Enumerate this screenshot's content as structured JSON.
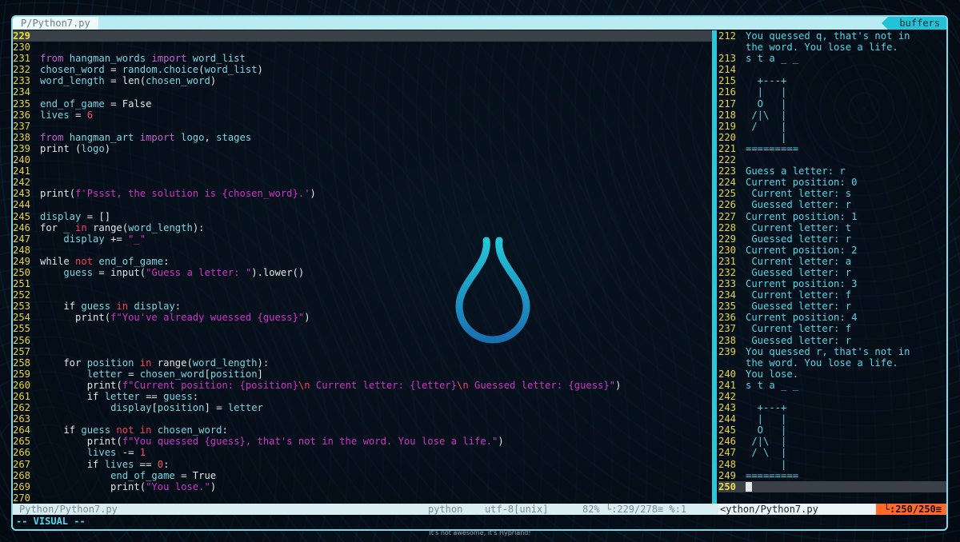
{
  "tabline": {
    "active_tab": "P/Python7.py",
    "buffers_label": "buffers"
  },
  "left_pane": {
    "lines": [
      {
        "n": "229",
        "current": true,
        "tokens": []
      },
      {
        "n": "230",
        "tokens": []
      },
      {
        "n": "231",
        "tokens": [
          [
            "kw",
            "from "
          ],
          [
            "id",
            "hangman_words "
          ],
          [
            "kw",
            "import "
          ],
          [
            "id",
            "word_list"
          ]
        ]
      },
      {
        "n": "232",
        "tokens": [
          [
            "id",
            "chosen_word "
          ],
          [
            "plain",
            "= "
          ],
          [
            "id",
            "random.choice"
          ],
          [
            "plain",
            "("
          ],
          [
            "id",
            "word_list"
          ],
          [
            "plain",
            ")"
          ]
        ]
      },
      {
        "n": "233",
        "tokens": [
          [
            "id",
            "word_length "
          ],
          [
            "plain",
            "= "
          ],
          [
            "plain",
            "len"
          ],
          [
            "plain",
            "("
          ],
          [
            "id",
            "chosen_word"
          ],
          [
            "plain",
            ")"
          ]
        ]
      },
      {
        "n": "234",
        "tokens": []
      },
      {
        "n": "235",
        "tokens": [
          [
            "id",
            "end_of_game "
          ],
          [
            "plain",
            "= False"
          ]
        ]
      },
      {
        "n": "236",
        "tokens": [
          [
            "id",
            "lives "
          ],
          [
            "plain",
            "= "
          ],
          [
            "num",
            "6"
          ]
        ]
      },
      {
        "n": "237",
        "tokens": []
      },
      {
        "n": "238",
        "tokens": [
          [
            "kw",
            "from "
          ],
          [
            "id",
            "hangman_art "
          ],
          [
            "kw",
            "import "
          ],
          [
            "id",
            "logo"
          ],
          [
            "plain",
            ", "
          ],
          [
            "id",
            "stages"
          ]
        ]
      },
      {
        "n": "239",
        "tokens": [
          [
            "plain",
            "print "
          ],
          [
            "plain",
            "("
          ],
          [
            "id",
            "logo"
          ],
          [
            "plain",
            ")"
          ]
        ]
      },
      {
        "n": "240",
        "tokens": []
      },
      {
        "n": "241",
        "tokens": []
      },
      {
        "n": "242",
        "tokens": []
      },
      {
        "n": "243",
        "tokens": [
          [
            "plain",
            "print"
          ],
          [
            "plain",
            "("
          ],
          [
            "str",
            "f'Pssst, the solution is {chosen_word}.'"
          ],
          [
            "plain",
            ")"
          ]
        ]
      },
      {
        "n": "244",
        "tokens": []
      },
      {
        "n": "245",
        "tokens": [
          [
            "id",
            "display "
          ],
          [
            "plain",
            "= []"
          ]
        ]
      },
      {
        "n": "246",
        "tokens": [
          [
            "plain",
            "for "
          ],
          [
            "id",
            "_ "
          ],
          [
            "op",
            "in "
          ],
          [
            "plain",
            "range"
          ],
          [
            "plain",
            "("
          ],
          [
            "id",
            "word_length"
          ],
          [
            "plain",
            "):"
          ]
        ]
      },
      {
        "n": "247",
        "tokens": [
          [
            "plain",
            "    "
          ],
          [
            "id",
            "display "
          ],
          [
            "plain",
            "+= "
          ],
          [
            "str",
            "\"_\""
          ]
        ]
      },
      {
        "n": "248",
        "tokens": []
      },
      {
        "n": "249",
        "tokens": [
          [
            "plain",
            "while "
          ],
          [
            "op",
            "not "
          ],
          [
            "id",
            "end_of_game"
          ],
          [
            "plain",
            ":"
          ]
        ]
      },
      {
        "n": "250",
        "tokens": [
          [
            "plain",
            "    "
          ],
          [
            "id",
            "guess "
          ],
          [
            "plain",
            "= input"
          ],
          [
            "plain",
            "("
          ],
          [
            "str",
            "\"Guess a letter: \""
          ],
          [
            "plain",
            ").lower()"
          ]
        ]
      },
      {
        "n": "251",
        "tokens": []
      },
      {
        "n": "252",
        "tokens": []
      },
      {
        "n": "253",
        "tokens": [
          [
            "plain",
            "    if "
          ],
          [
            "id",
            "guess "
          ],
          [
            "op",
            "in "
          ],
          [
            "id",
            "display"
          ],
          [
            "plain",
            ":"
          ]
        ]
      },
      {
        "n": "254",
        "tokens": [
          [
            "plain",
            "      print"
          ],
          [
            "plain",
            "("
          ],
          [
            "str",
            "f\"You've already wuessed {guess}\""
          ],
          [
            "plain",
            ")"
          ]
        ]
      },
      {
        "n": "255",
        "tokens": []
      },
      {
        "n": "256",
        "tokens": []
      },
      {
        "n": "257",
        "tokens": []
      },
      {
        "n": "258",
        "tokens": [
          [
            "plain",
            "    for "
          ],
          [
            "id",
            "position "
          ],
          [
            "op",
            "in "
          ],
          [
            "plain",
            "range"
          ],
          [
            "plain",
            "("
          ],
          [
            "id",
            "word_length"
          ],
          [
            "plain",
            "):"
          ]
        ]
      },
      {
        "n": "259",
        "tokens": [
          [
            "plain",
            "        "
          ],
          [
            "id",
            "letter "
          ],
          [
            "plain",
            "= "
          ],
          [
            "id",
            "chosen_word"
          ],
          [
            "plain",
            "["
          ],
          [
            "id",
            "position"
          ],
          [
            "plain",
            "]"
          ]
        ]
      },
      {
        "n": "260",
        "tokens": [
          [
            "plain",
            "        print"
          ],
          [
            "plain",
            "("
          ],
          [
            "str",
            "f\"Current position: {position}"
          ],
          [
            "op",
            "\\n"
          ],
          [
            "str",
            " Current letter: {letter}"
          ],
          [
            "op",
            "\\n"
          ],
          [
            "str",
            " Guessed letter: {guess}\""
          ],
          [
            "plain",
            ")"
          ]
        ]
      },
      {
        "n": "261",
        "tokens": [
          [
            "plain",
            "        if "
          ],
          [
            "id",
            "letter "
          ],
          [
            "plain",
            "== "
          ],
          [
            "id",
            "guess"
          ],
          [
            "plain",
            ":"
          ]
        ]
      },
      {
        "n": "262",
        "tokens": [
          [
            "plain",
            "            "
          ],
          [
            "id",
            "display"
          ],
          [
            "plain",
            "["
          ],
          [
            "id",
            "position"
          ],
          [
            "plain",
            "] = "
          ],
          [
            "id",
            "letter"
          ]
        ]
      },
      {
        "n": "263",
        "tokens": []
      },
      {
        "n": "264",
        "tokens": [
          [
            "plain",
            "    if "
          ],
          [
            "id",
            "guess "
          ],
          [
            "op",
            "not in "
          ],
          [
            "id",
            "chosen_word"
          ],
          [
            "plain",
            ":"
          ]
        ]
      },
      {
        "n": "265",
        "tokens": [
          [
            "plain",
            "        print"
          ],
          [
            "plain",
            "("
          ],
          [
            "str",
            "f\"You quessed {guess}, that's not in the word. You lose a life.\""
          ],
          [
            "plain",
            ")"
          ]
        ]
      },
      {
        "n": "266",
        "tokens": [
          [
            "plain",
            "        "
          ],
          [
            "id",
            "lives "
          ],
          [
            "plain",
            "-= "
          ],
          [
            "num",
            "1"
          ]
        ]
      },
      {
        "n": "267",
        "tokens": [
          [
            "plain",
            "        if "
          ],
          [
            "id",
            "lives "
          ],
          [
            "plain",
            "== "
          ],
          [
            "num",
            "0"
          ],
          [
            "plain",
            ":"
          ]
        ]
      },
      {
        "n": "268",
        "tokens": [
          [
            "plain",
            "            "
          ],
          [
            "id",
            "end_of_game "
          ],
          [
            "plain",
            "= True"
          ]
        ]
      },
      {
        "n": "269",
        "tokens": [
          [
            "plain",
            "            print"
          ],
          [
            "plain",
            "("
          ],
          [
            "str",
            "\"You lose.\""
          ],
          [
            "plain",
            ")"
          ]
        ]
      },
      {
        "n": "270",
        "tokens": []
      }
    ]
  },
  "right_pane": {
    "lines": [
      {
        "n": "212",
        "text": "You quessed q, that's not in"
      },
      {
        "n": "",
        "text": "the word. You lose a life."
      },
      {
        "n": "213",
        "text": "s t a _ _"
      },
      {
        "n": "214",
        "text": ""
      },
      {
        "n": "215",
        "text": "  +---+"
      },
      {
        "n": "216",
        "text": "  |   |"
      },
      {
        "n": "217",
        "text": "  O   |"
      },
      {
        "n": "218",
        "text": " /|\\  |"
      },
      {
        "n": "219",
        "text": " /    |"
      },
      {
        "n": "220",
        "text": "      |"
      },
      {
        "n": "221",
        "text": "========="
      },
      {
        "n": "222",
        "text": ""
      },
      {
        "n": "223",
        "text": "Guess a letter: r"
      },
      {
        "n": "224",
        "text": "Current position: 0"
      },
      {
        "n": "225",
        "text": " Current letter: s"
      },
      {
        "n": "226",
        "text": " Guessed letter: r"
      },
      {
        "n": "227",
        "text": "Current position: 1"
      },
      {
        "n": "228",
        "text": " Current letter: t"
      },
      {
        "n": "229",
        "text": " Guessed letter: r"
      },
      {
        "n": "230",
        "text": "Current position: 2"
      },
      {
        "n": "231",
        "text": " Current letter: a"
      },
      {
        "n": "232",
        "text": " Guessed letter: r"
      },
      {
        "n": "233",
        "text": "Current position: 3"
      },
      {
        "n": "234",
        "text": " Current letter: f"
      },
      {
        "n": "235",
        "text": " Guessed letter: r"
      },
      {
        "n": "236",
        "text": "Current position: 4"
      },
      {
        "n": "237",
        "text": " Current letter: f"
      },
      {
        "n": "238",
        "text": " Guessed letter: r"
      },
      {
        "n": "239",
        "text": "You quessed r, that's not in"
      },
      {
        "n": "",
        "text": "the word. You lose a life."
      },
      {
        "n": "240",
        "text": "You lose."
      },
      {
        "n": "241",
        "text": "s t a _ _"
      },
      {
        "n": "242",
        "text": ""
      },
      {
        "n": "243",
        "text": "  +---+"
      },
      {
        "n": "244",
        "text": "  |   |"
      },
      {
        "n": "245",
        "text": "  O   |"
      },
      {
        "n": "246",
        "text": " /|\\  |"
      },
      {
        "n": "247",
        "text": " / \\  |"
      },
      {
        "n": "248",
        "text": "      |"
      },
      {
        "n": "249",
        "text": "========="
      },
      {
        "n": "250",
        "text": "",
        "current": true
      }
    ]
  },
  "statusline": {
    "left_file": "Python/Python7.py",
    "filetype": "python",
    "encoding": "utf-8[unix]",
    "position": "82% └:229/278≡ %:1",
    "right_file": "<ython/Python7.py",
    "right_position": "└:250/250≡"
  },
  "cmdline": {
    "mode": "-- VISUAL --"
  },
  "desktop": {
    "message": "It's not awesome, it's Hyprland!"
  },
  "colors": {
    "accent": "#22c3d6",
    "line_numbers": "#e6d23a",
    "orange": "#ff6a2a"
  }
}
